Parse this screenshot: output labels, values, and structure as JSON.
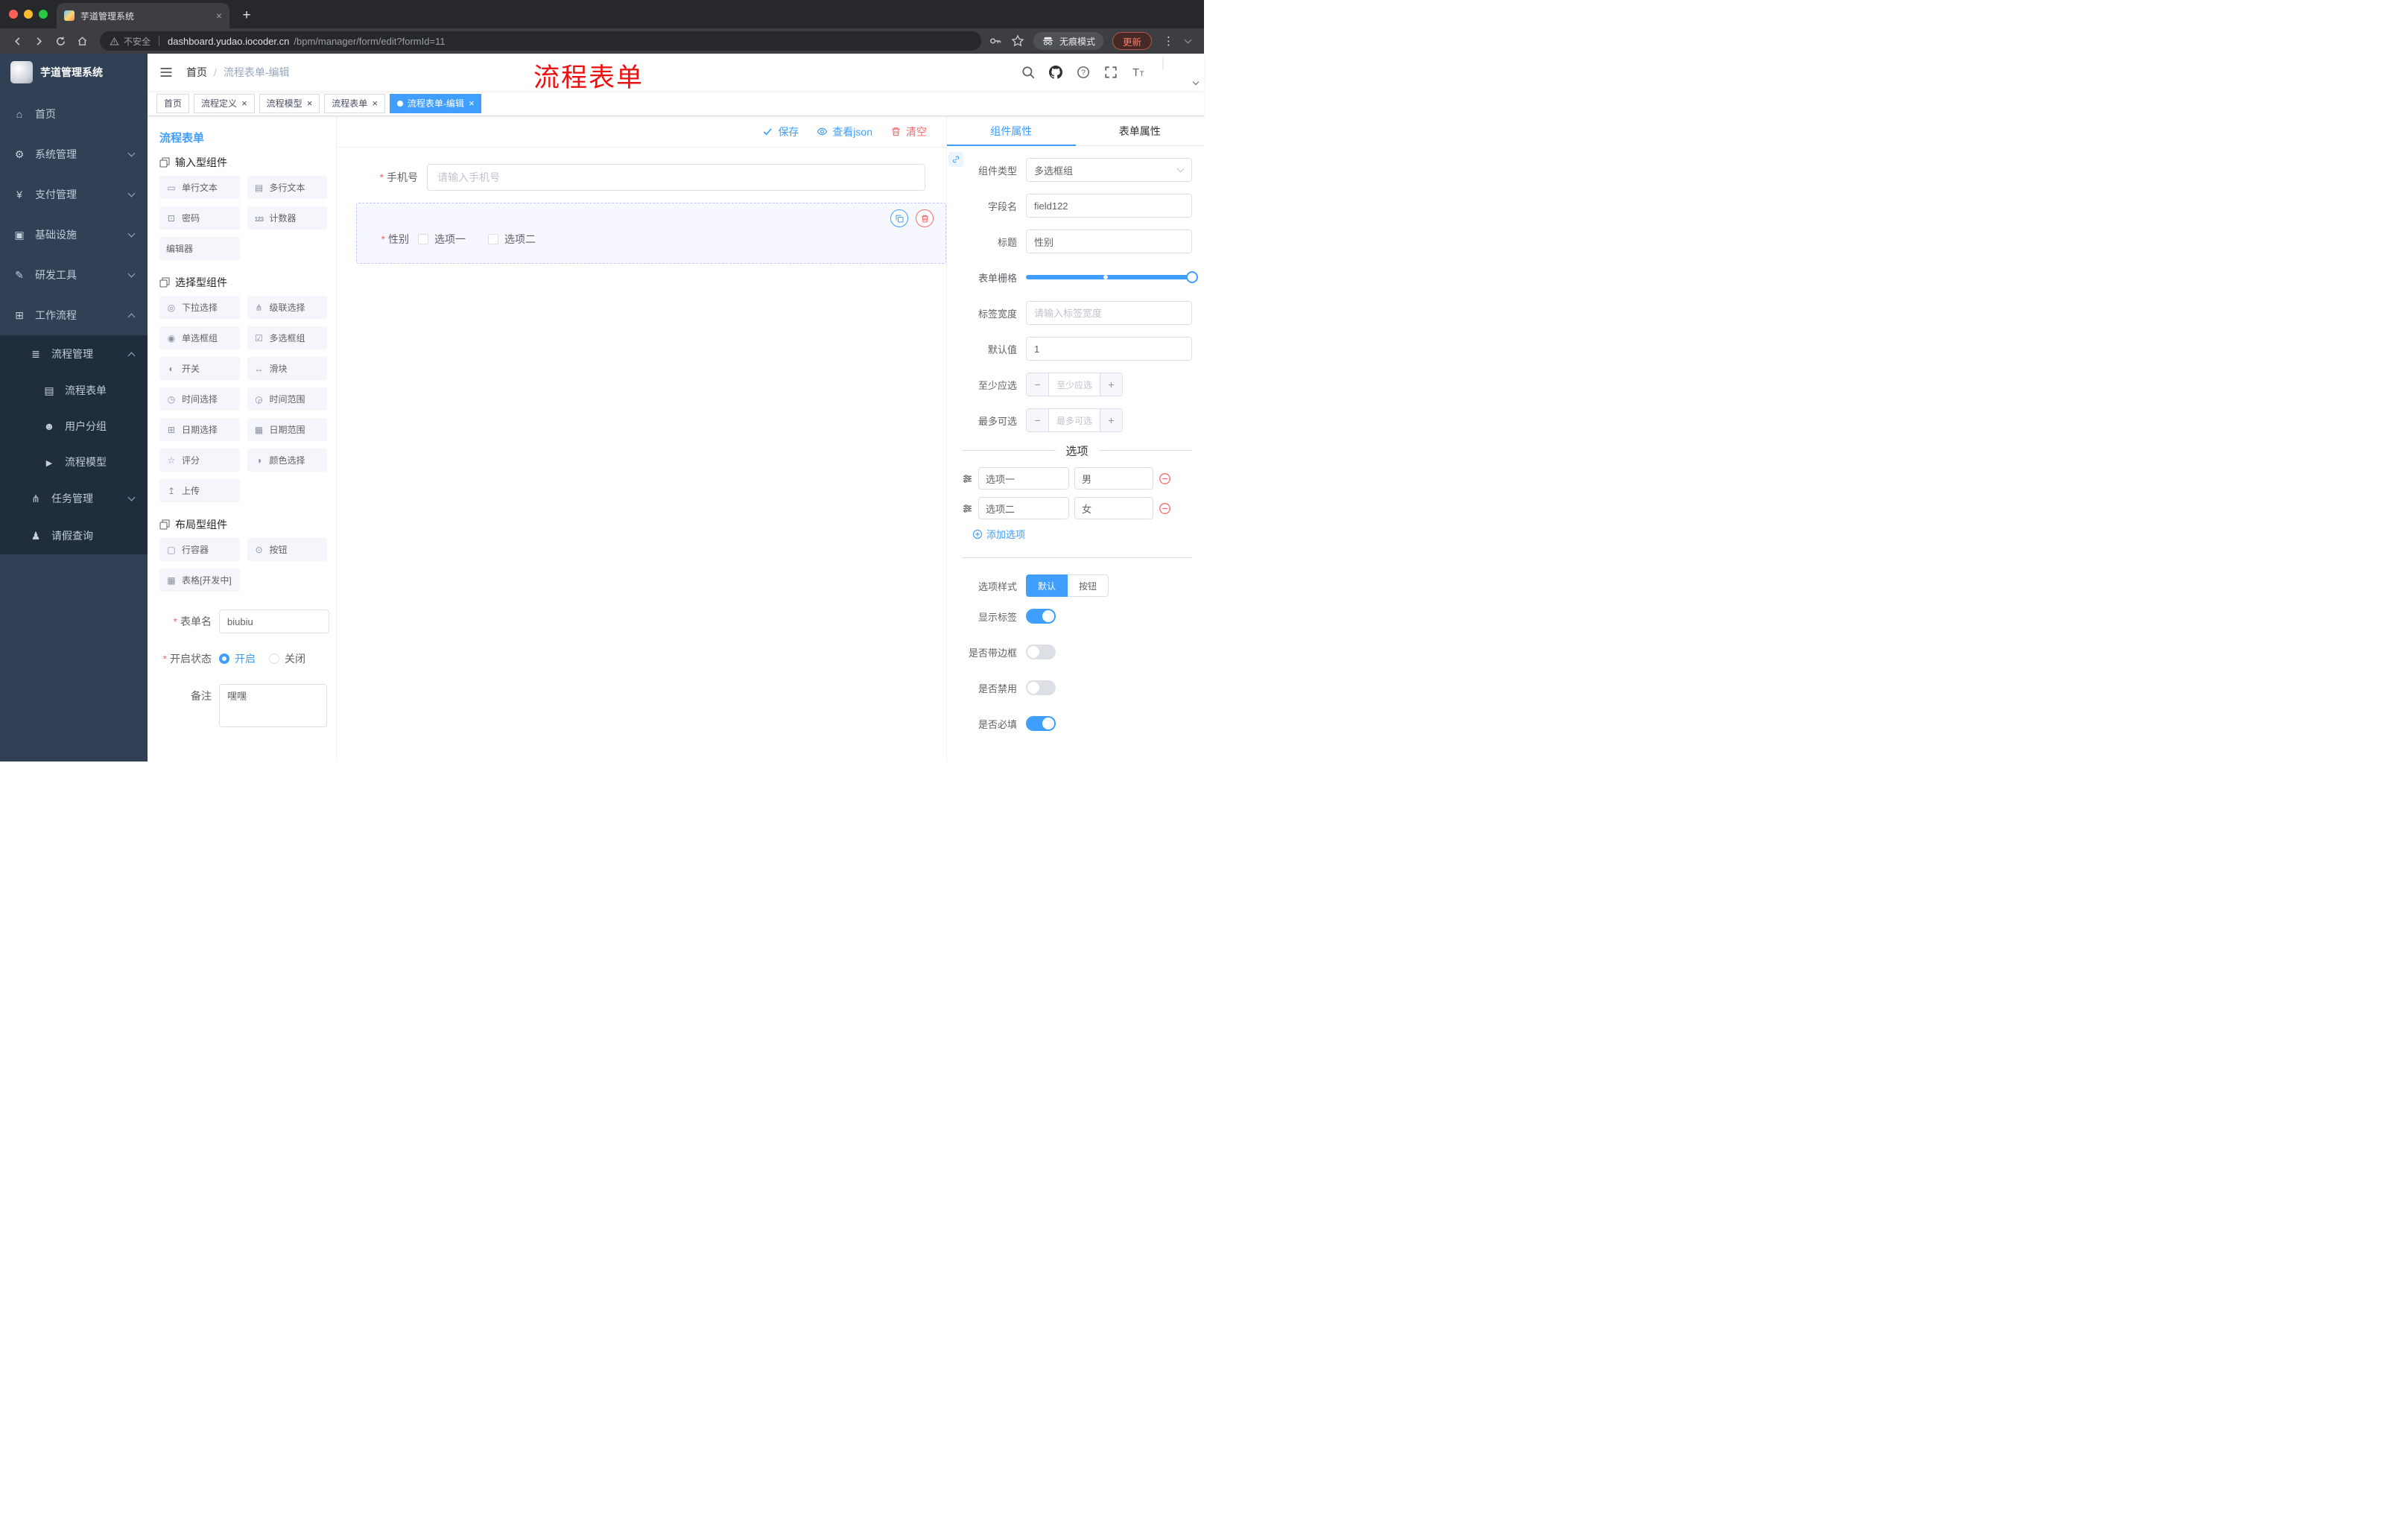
{
  "browser": {
    "tab_title": "芋道管理系统",
    "security": "不安全",
    "url_host": "dashboard.yudao.iocoder.cn",
    "url_path": "/bpm/manager/form/edit?formId=11",
    "incognito": "无痕模式",
    "update": "更新"
  },
  "sidebar": {
    "logo": "芋道管理系统",
    "menu": [
      {
        "label": "首页"
      },
      {
        "label": "系统管理"
      },
      {
        "label": "支付管理"
      },
      {
        "label": "基础设施"
      },
      {
        "label": "研发工具"
      },
      {
        "label": "工作流程"
      },
      {
        "label": "流程管理"
      },
      {
        "label": "流程表单"
      },
      {
        "label": "用户分组"
      },
      {
        "label": "流程模型"
      },
      {
        "label": "任务管理"
      },
      {
        "label": "请假查询"
      }
    ]
  },
  "navbar": {
    "breadcrumb_home": "首页",
    "breadcrumb_current": "流程表单-编辑",
    "annotation": "流程表单"
  },
  "tags": [
    {
      "label": "首页"
    },
    {
      "label": "流程定义"
    },
    {
      "label": "流程模型"
    },
    {
      "label": "流程表单"
    },
    {
      "label": "流程表单-编辑"
    }
  ],
  "panel_left": {
    "title": "流程表单",
    "group_input": {
      "title": "输入型组件",
      "items": [
        "单行文本",
        "多行文本",
        "密码",
        "计数器",
        "编辑器"
      ]
    },
    "group_select": {
      "title": "选择型组件",
      "items": [
        "下拉选择",
        "级联选择",
        "单选框组",
        "多选框组",
        "开关",
        "滑块",
        "时间选择",
        "时间范围",
        "日期选择",
        "日期范围",
        "评分",
        "颜色选择",
        "上传"
      ]
    },
    "group_layout": {
      "title": "布局型组件",
      "items": [
        "行容器",
        "按钮",
        "表格[开发中]"
      ]
    },
    "form": {
      "name_label": "表单名",
      "name_value": "biubiu",
      "status_label": "开启状态",
      "status_on": "开启",
      "status_off": "关闭",
      "remark_label": "备注",
      "remark_value": "嘿嘿"
    }
  },
  "canvas": {
    "save": "保存",
    "view_json": "查看json",
    "clear": "清空",
    "phone_label": "手机号",
    "phone_placeholder": "请输入手机号",
    "gender_label": "性别",
    "gender_opt1": "选项一",
    "gender_opt2": "选项二"
  },
  "props": {
    "tab_component": "组件属性",
    "tab_form": "表单属性",
    "type_label": "组件类型",
    "type_value": "多选框组",
    "field_label": "字段名",
    "field_value": "field122",
    "title_label": "标题",
    "title_value": "性别",
    "grid_label": "表单栅格",
    "width_label": "标签宽度",
    "width_placeholder": "请输入标签宽度",
    "default_label": "默认值",
    "default_value": "1",
    "min_label": "至少应选",
    "min_placeholder": "至少应选",
    "max_label": "最多可选",
    "max_placeholder": "最多可选",
    "options_title": "选项",
    "options": [
      {
        "label": "选项一",
        "value": "男"
      },
      {
        "label": "选项二",
        "value": "女"
      }
    ],
    "add_option": "添加选项",
    "style_label": "选项样式",
    "style_default": "默认",
    "style_button": "按钮",
    "show_label": "显示标签",
    "border_label": "是否带边框",
    "disabled_label": "是否禁用",
    "required_label": "是否必填"
  },
  "colors": {
    "accent": "#409eff",
    "danger": "#f56c6c",
    "sidebar_bg": "#304156",
    "sidebar_sub_bg": "#1f2d3d",
    "annotation_red": "#ee0f0f"
  }
}
